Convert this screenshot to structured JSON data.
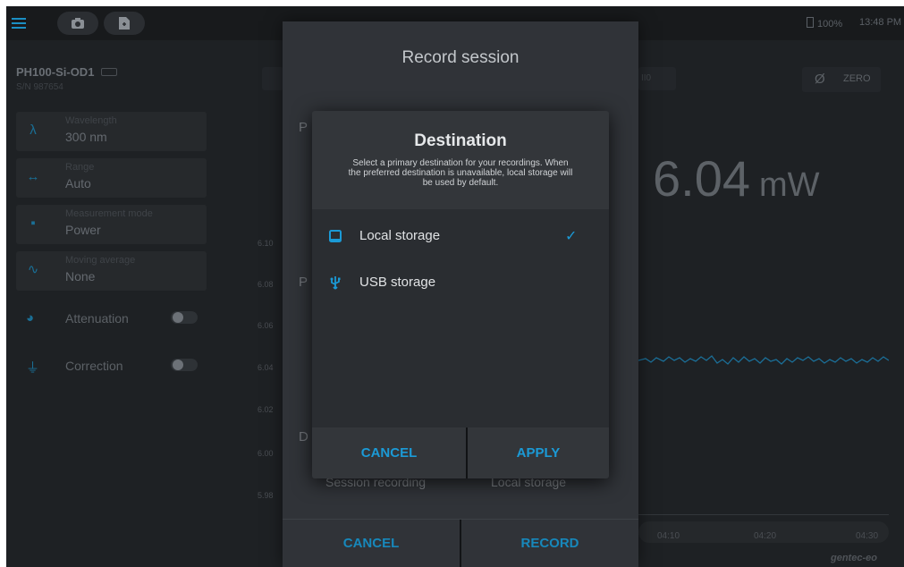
{
  "status": {
    "battery": "100%",
    "time": "13:48 PM"
  },
  "device": {
    "name": "PH100-Si-OD1",
    "serial": "S/N 987654"
  },
  "sidebar": {
    "cards": [
      {
        "label": "Wavelength",
        "value": "300 nm",
        "icon": "lambda-icon"
      },
      {
        "label": "Range",
        "value": "Auto",
        "icon": "range-icon"
      },
      {
        "label": "Measurement mode",
        "value": "Power",
        "icon": "grid-icon"
      },
      {
        "label": "Moving average",
        "value": "None",
        "icon": "wave-icon"
      }
    ],
    "toggles": [
      {
        "label": "Attenuation",
        "on": false
      },
      {
        "label": "Correction",
        "on": false
      }
    ]
  },
  "main": {
    "zero_label": "ZERO",
    "tab_partial": "II0",
    "reading_value": "6.04",
    "reading_unit": "mW",
    "y_ticks": [
      "6.10",
      "6.08",
      "6.06",
      "6.04",
      "6.02",
      "6.00",
      "5.98"
    ],
    "x_ticks": [
      "04:10",
      "04:20",
      "04:30"
    ],
    "brand": "gentec-eo"
  },
  "record_dialog": {
    "title": "Record session",
    "section_letters": [
      "P",
      "P",
      "D"
    ],
    "hidden_row_left": "Session recording",
    "hidden_row_right": "Local storage",
    "cancel": "CANCEL",
    "record": "RECORD"
  },
  "destination_dialog": {
    "title": "Destination",
    "description": "Select a primary destination for your recordings. When the preferred destination is unavailable, local storage will be used by default.",
    "options": [
      {
        "label": "Local storage",
        "selected": true
      },
      {
        "label": "USB storage",
        "selected": false
      }
    ],
    "cancel": "CANCEL",
    "apply": "APPLY"
  }
}
